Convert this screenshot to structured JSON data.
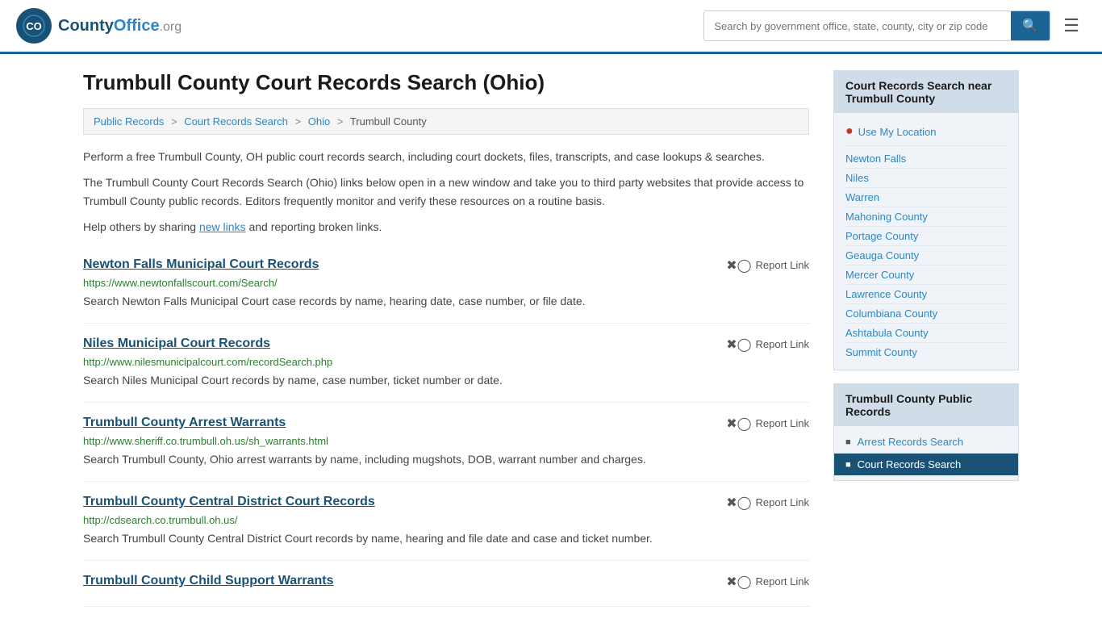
{
  "header": {
    "logo_text": "County",
    "logo_org": "Office.org",
    "search_placeholder": "Search by government office, state, county, city or zip code"
  },
  "page": {
    "title": "Trumbull County Court Records Search (Ohio)",
    "breadcrumb": [
      {
        "label": "Public Records",
        "href": "#"
      },
      {
        "label": "Court Records Search",
        "href": "#"
      },
      {
        "label": "Ohio",
        "href": "#"
      },
      {
        "label": "Trumbull County",
        "href": "#"
      }
    ],
    "description1": "Perform a free Trumbull County, OH public court records search, including court dockets, files, transcripts, and case lookups & searches.",
    "description2": "The Trumbull County Court Records Search (Ohio) links below open in a new window and take you to third party websites that provide access to Trumbull County public records. Editors frequently monitor and verify these resources on a routine basis.",
    "description3_pre": "Help others by sharing ",
    "description3_link": "new links",
    "description3_post": " and reporting broken links."
  },
  "records": [
    {
      "title": "Newton Falls Municipal Court Records",
      "url": "https://www.newtonfallscourt.com/Search/",
      "desc": "Search Newton Falls Municipal Court case records by name, hearing date, case number, or file date.",
      "report_label": "Report Link"
    },
    {
      "title": "Niles Municipal Court Records",
      "url": "http://www.nilesmunicipalcourt.com/recordSearch.php",
      "desc": "Search Niles Municipal Court records by name, case number, ticket number or date.",
      "report_label": "Report Link"
    },
    {
      "title": "Trumbull County Arrest Warrants",
      "url": "http://www.sheriff.co.trumbull.oh.us/sh_warrants.html",
      "desc": "Search Trumbull County, Ohio arrest warrants by name, including mugshots, DOB, warrant number and charges.",
      "report_label": "Report Link"
    },
    {
      "title": "Trumbull County Central District Court Records",
      "url": "http://cdsearch.co.trumbull.oh.us/",
      "desc": "Search Trumbull County Central District Court records by name, hearing and file date and case and ticket number.",
      "report_label": "Report Link"
    },
    {
      "title": "Trumbull County Child Support Warrants",
      "url": "",
      "desc": "",
      "report_label": "Report Link"
    }
  ],
  "sidebar": {
    "nearby_title": "Court Records Search near Trumbull County",
    "use_location": "Use My Location",
    "nearby_links": [
      "Newton Falls",
      "Niles",
      "Warren",
      "Mahoning County",
      "Portage County",
      "Geauga County",
      "Mercer County",
      "Lawrence County",
      "Columbiana County",
      "Ashtabula County",
      "Summit County"
    ],
    "public_records_title": "Trumbull County Public Records",
    "public_records_links": [
      {
        "label": "Arrest Records Search",
        "active": false
      },
      {
        "label": "Court Records Search",
        "active": true
      }
    ]
  }
}
